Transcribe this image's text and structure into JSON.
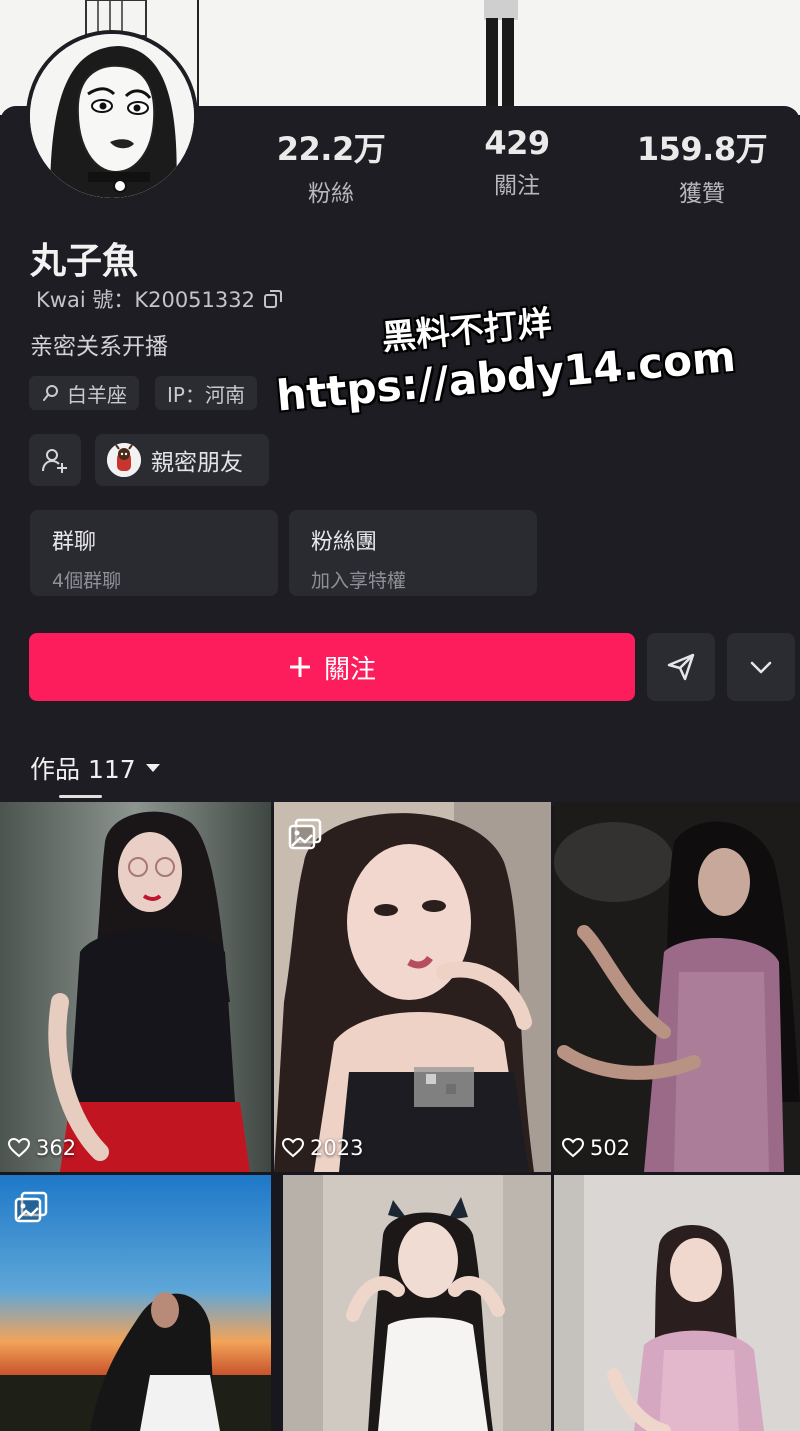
{
  "profile": {
    "name": "丸子魚",
    "kwai_id": "Kwai 號：K20051332",
    "bio": "亲密关系开播",
    "tags": [
      "白羊座",
      "IP：河南"
    ],
    "friend_label": "親密朋友"
  },
  "stats": [
    {
      "value": "22.2万",
      "label": "粉絲"
    },
    {
      "value": "429",
      "label": "關注"
    },
    {
      "value": "159.8万",
      "label": "獲贊"
    }
  ],
  "cards": [
    {
      "title": "群聊",
      "subtitle": "4個群聊"
    },
    {
      "title": "粉絲團",
      "subtitle": "加入享特權"
    }
  ],
  "actions": {
    "follow_label": "關注",
    "follow_color": "#fe1d5c"
  },
  "tabs": {
    "works_label": "作品 117"
  },
  "watermark": {
    "line1": "黑料不打烊",
    "line2": "https://abdy14.com"
  },
  "posts": [
    {
      "likes": "362",
      "gallery": false
    },
    {
      "likes": "2023",
      "gallery": true
    },
    {
      "likes": "502",
      "gallery": false
    },
    {
      "likes": "",
      "gallery": true
    },
    {
      "likes": "",
      "gallery": false
    },
    {
      "likes": "",
      "gallery": false
    }
  ],
  "icons": [
    "copy-icon",
    "search-icon",
    "add-friend-icon",
    "plus-icon",
    "send-icon",
    "chevron-down-icon",
    "caret-down-icon",
    "heart-icon",
    "gallery-icon"
  ]
}
